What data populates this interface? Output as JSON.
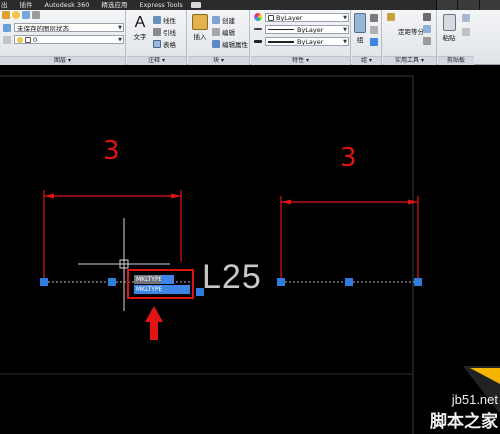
{
  "menubar": {
    "items": [
      "出",
      "插件",
      "Autodesk 360",
      "精选应用",
      "Express Tools"
    ]
  },
  "ribbon": {
    "layer_panel": {
      "layer_state": "未保存的图层状态",
      "layer_current": "0",
      "title": "图层 ▾"
    },
    "annotation_panel": {
      "text_label": "文字",
      "linear_label": "线性",
      "leader_label": "引线",
      "table_label": "表格",
      "title": "注释 ▾"
    },
    "block_panel": {
      "insert_label": "插入",
      "create_label": "创建",
      "edit_label": "编辑",
      "edit_attr_label": "编辑属性",
      "title": "块 ▾"
    },
    "properties_panel": {
      "color_value": "ByLayer",
      "linetype_value": "ByLayer",
      "lineweight_value": "ByLayer",
      "title": "特性 ▾"
    },
    "group_panel": {
      "group_label": "组",
      "title": "组 ▾"
    },
    "utilities_panel": {
      "measure_label": "定距等分",
      "title": "实用工具 ▾"
    },
    "clipboard_panel": {
      "paste_label": "粘贴",
      "title": "剪贴板"
    }
  },
  "drawing": {
    "dim_left_value": "3",
    "dim_right_value": "3",
    "typed_text": "L25",
    "tooltip_top": "MKLTYPE",
    "tooltip_bottom": "MKLTYPE"
  },
  "watermark": {
    "site": "jb51.net",
    "name": "脚本之家"
  },
  "colors": {
    "dimension": "#e01414",
    "grip": "#2f7de1",
    "tooltip_highlight": "#3d86e6",
    "canvas_background": "#000000"
  }
}
